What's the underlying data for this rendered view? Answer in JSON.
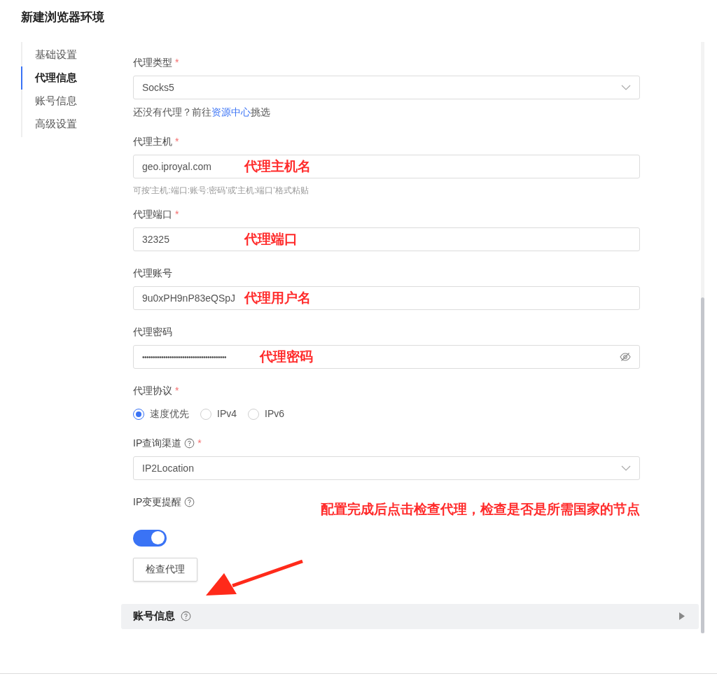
{
  "title": "新建浏览器环境",
  "nav": [
    {
      "label": "基础设置",
      "selected": false
    },
    {
      "label": "代理信息",
      "selected": true
    },
    {
      "label": "账号信息",
      "selected": false
    },
    {
      "label": "高级设置",
      "selected": false
    }
  ],
  "fields": [
    {
      "kind": "select",
      "label": "代理类型",
      "mark": "*",
      "value": "Socks5",
      "hint": {
        "before": "还没有代理？前往",
        "link": "资源中心",
        "after": "挑选"
      }
    },
    {
      "kind": "input",
      "label": "代理主机",
      "mark": "*",
      "value": "geo.iproyal.com",
      "annotation": "代理主机名",
      "note": "可按'主机:端口:账号:密码'或'主机:端口'格式粘贴"
    },
    {
      "kind": "input",
      "label": "代理端口",
      "mark": "*",
      "value": "32325",
      "annotation": "代理端口"
    },
    {
      "kind": "input",
      "label": "代理账号",
      "value": "9u0xPH9nP83eQSpJ",
      "annotation": "代理用户名"
    },
    {
      "kind": "password",
      "label": "代理密码",
      "value": "••••••••••••••••••••••••••••••••••••••••",
      "annotation": "代理密码"
    },
    {
      "kind": "radio",
      "label": "代理协议",
      "mark": "*",
      "options": [
        {
          "label": "速度优先",
          "selected": true
        },
        {
          "label": "IPv4",
          "selected": false
        },
        {
          "label": "IPv6",
          "selected": false
        }
      ]
    },
    {
      "kind": "select",
      "label": "IP查询渠道",
      "help": true,
      "mark": "*",
      "value": "IP2Location"
    },
    {
      "kind": "switch",
      "label": "IP变更提醒",
      "help": true,
      "on": true,
      "callout": "配置完成后点击检查代理，检查是否是所需国家的节点"
    }
  ],
  "check_button": "检查代理",
  "section": {
    "title": "账号信息",
    "help": true,
    "expanded": false
  }
}
